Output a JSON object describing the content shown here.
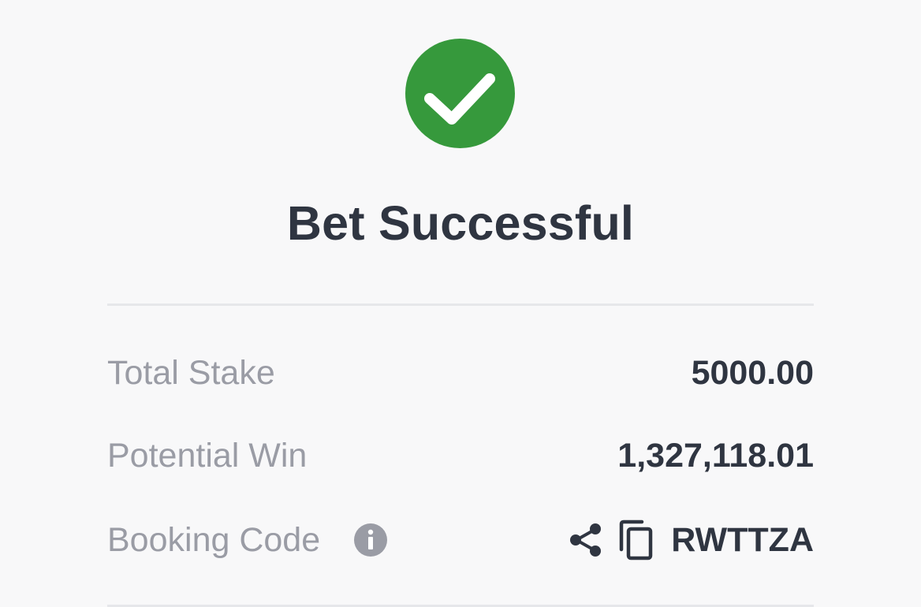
{
  "status": {
    "icon": "checkmark-circle-icon",
    "title": "Bet Successful",
    "accent_color": "#36993c"
  },
  "summary": {
    "total_stake_label": "Total Stake",
    "total_stake_value": "5000.00",
    "potential_win_label": "Potential Win",
    "potential_win_value": "1,327,118.01",
    "booking_code_label": "Booking Code",
    "booking_code_value": "RWTTZA",
    "info_icon": "info-icon",
    "share_icon": "share-icon",
    "copy_icon": "copy-icon"
  }
}
